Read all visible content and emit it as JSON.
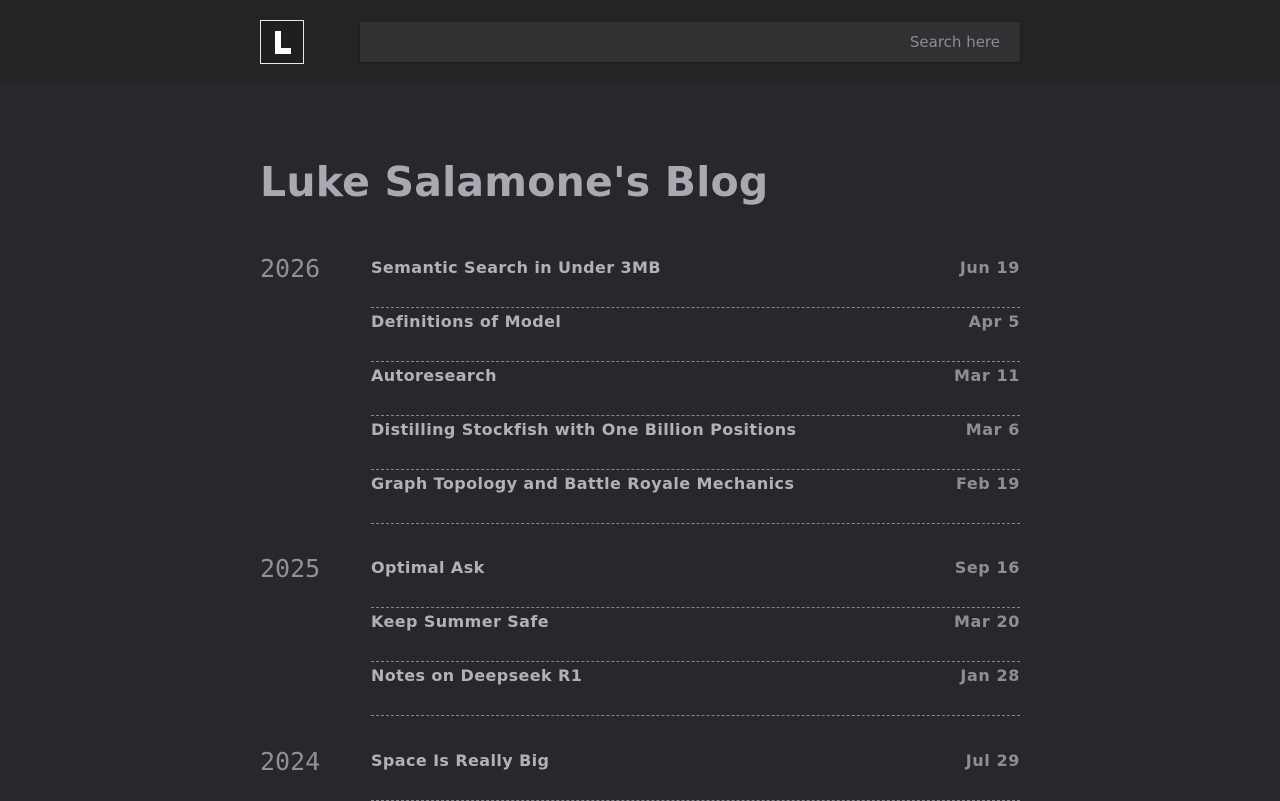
{
  "header": {
    "logo_letter": "L",
    "search_placeholder": "Search here"
  },
  "page_title": "Luke Salamone's Blog",
  "years": [
    {
      "year": "2026",
      "posts": [
        {
          "title": "Semantic Search in Under 3MB",
          "date": "Jun 19"
        },
        {
          "title": "Definitions of Model",
          "date": "Apr 5"
        },
        {
          "title": "Autoresearch",
          "date": "Mar 11"
        },
        {
          "title": "Distilling Stockfish with One Billion Positions",
          "date": "Mar 6"
        },
        {
          "title": "Graph Topology and Battle Royale Mechanics",
          "date": "Feb 19"
        }
      ]
    },
    {
      "year": "2025",
      "posts": [
        {
          "title": "Optimal Ask",
          "date": "Sep 16"
        },
        {
          "title": "Keep Summer Safe",
          "date": "Mar 20"
        },
        {
          "title": "Notes on Deepseek R1",
          "date": "Jan 28"
        }
      ]
    },
    {
      "year": "2024",
      "posts": [
        {
          "title": "Space Is Really Big",
          "date": "Jul 29"
        }
      ]
    }
  ]
}
